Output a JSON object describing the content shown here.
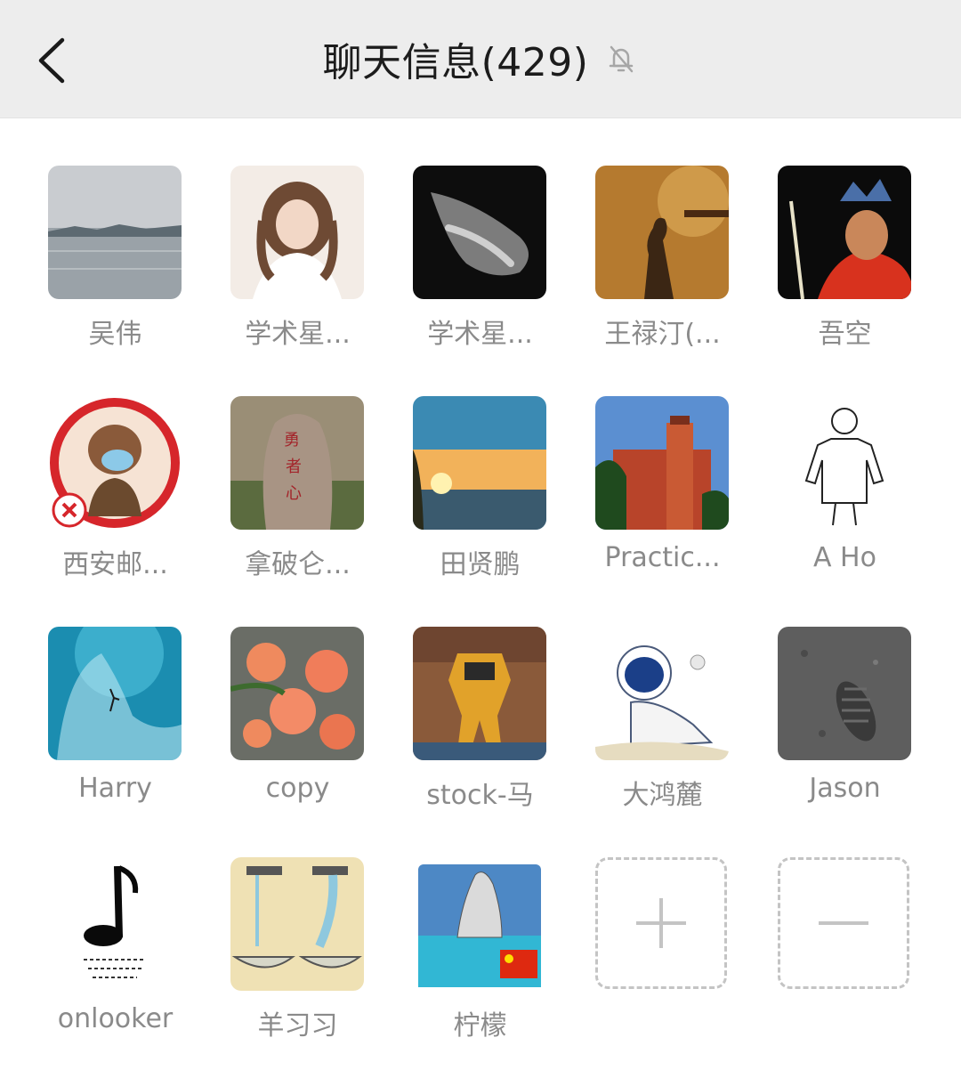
{
  "header": {
    "title": "聊天信息(429)",
    "back_icon": "chevron-left-icon",
    "mute_icon": "bell-off-icon"
  },
  "members": [
    {
      "name": "吴伟"
    },
    {
      "name": "学术星..."
    },
    {
      "name": "学术星..."
    },
    {
      "name": "王禄汀(..."
    },
    {
      "name": "吾空"
    },
    {
      "name": "西安邮..."
    },
    {
      "name": "拿破仑..."
    },
    {
      "name": "田贤鹏"
    },
    {
      "name": "Practic..."
    },
    {
      "name": "A Ho"
    },
    {
      "name": "Harry"
    },
    {
      "name": "copy"
    },
    {
      "name": "stock-马"
    },
    {
      "name": "大鸿麓"
    },
    {
      "name": "Jason"
    },
    {
      "name": "onlooker"
    },
    {
      "name": "羊习习"
    },
    {
      "name": "柠檬"
    }
  ],
  "actions": {
    "add_icon": "plus-icon",
    "remove_icon": "minus-icon"
  },
  "colors": {
    "header_bg": "#ededed",
    "name_text": "#8a8a8a",
    "dashed_border": "#c4c4c4"
  }
}
